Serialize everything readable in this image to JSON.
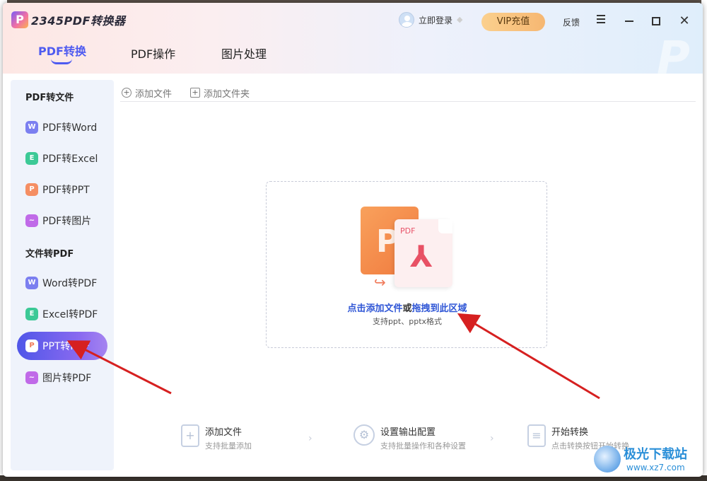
{
  "app": {
    "title": "2345PDF转换器",
    "logo_letter": "P",
    "login_label": "立即登录",
    "vip_label": "VIP充值",
    "feedback_label": "反馈"
  },
  "tabs": [
    {
      "label": "PDF转换",
      "active": true
    },
    {
      "label": "PDF操作",
      "active": false
    },
    {
      "label": "图片处理",
      "active": false
    }
  ],
  "sidebar": {
    "section1": "PDF转文件",
    "items1": [
      {
        "label": "PDF转Word",
        "icon_letter": "W",
        "icon": "word-icon",
        "color": "#7b7ff0"
      },
      {
        "label": "PDF转Excel",
        "icon_letter": "E",
        "icon": "excel-icon",
        "color": "#3cc996"
      },
      {
        "label": "PDF转PPT",
        "icon_letter": "P",
        "icon": "ppt-icon",
        "color": "#f58e63"
      },
      {
        "label": "PDF转图片",
        "icon_letter": "~",
        "icon": "image-icon",
        "color": "#c06ae8"
      }
    ],
    "section2": "文件转PDF",
    "items2": [
      {
        "label": "Word转PDF",
        "icon_letter": "W",
        "icon": "word-icon",
        "color": "#7b7ff0"
      },
      {
        "label": "Excel转PDF",
        "icon_letter": "E",
        "icon": "excel-icon",
        "color": "#3cc996"
      },
      {
        "label": "PPT转PDF",
        "icon_letter": "P",
        "icon": "ppt-icon",
        "color": "#f58e63",
        "active": true
      },
      {
        "label": "图片转PDF",
        "icon_letter": "~",
        "icon": "image-icon",
        "color": "#c06ae8"
      }
    ]
  },
  "toolbar": {
    "add_file": "添加文件",
    "add_folder": "添加文件夹"
  },
  "dropzone": {
    "pdf_label": "PDF",
    "text_link1": "点击添加文件",
    "text_or": "或",
    "text_link2": "拖拽到此区域",
    "subtext": "支持ppt、pptx格式"
  },
  "steps": [
    {
      "title": "添加文件",
      "desc": "支持批量添加",
      "icon": "add-file-icon"
    },
    {
      "title": "设置输出配置",
      "desc": "支持批量操作和各种设置",
      "icon": "settings-icon"
    },
    {
      "title": "开始转换",
      "desc": "点击转换按钮开始转换",
      "icon": "document-icon"
    }
  ],
  "watermark": {
    "name": "极光下载站",
    "url": "www.xz7.com"
  },
  "colors": {
    "accent": "#4e5bf0",
    "annotation_arrow": "#d62020"
  }
}
